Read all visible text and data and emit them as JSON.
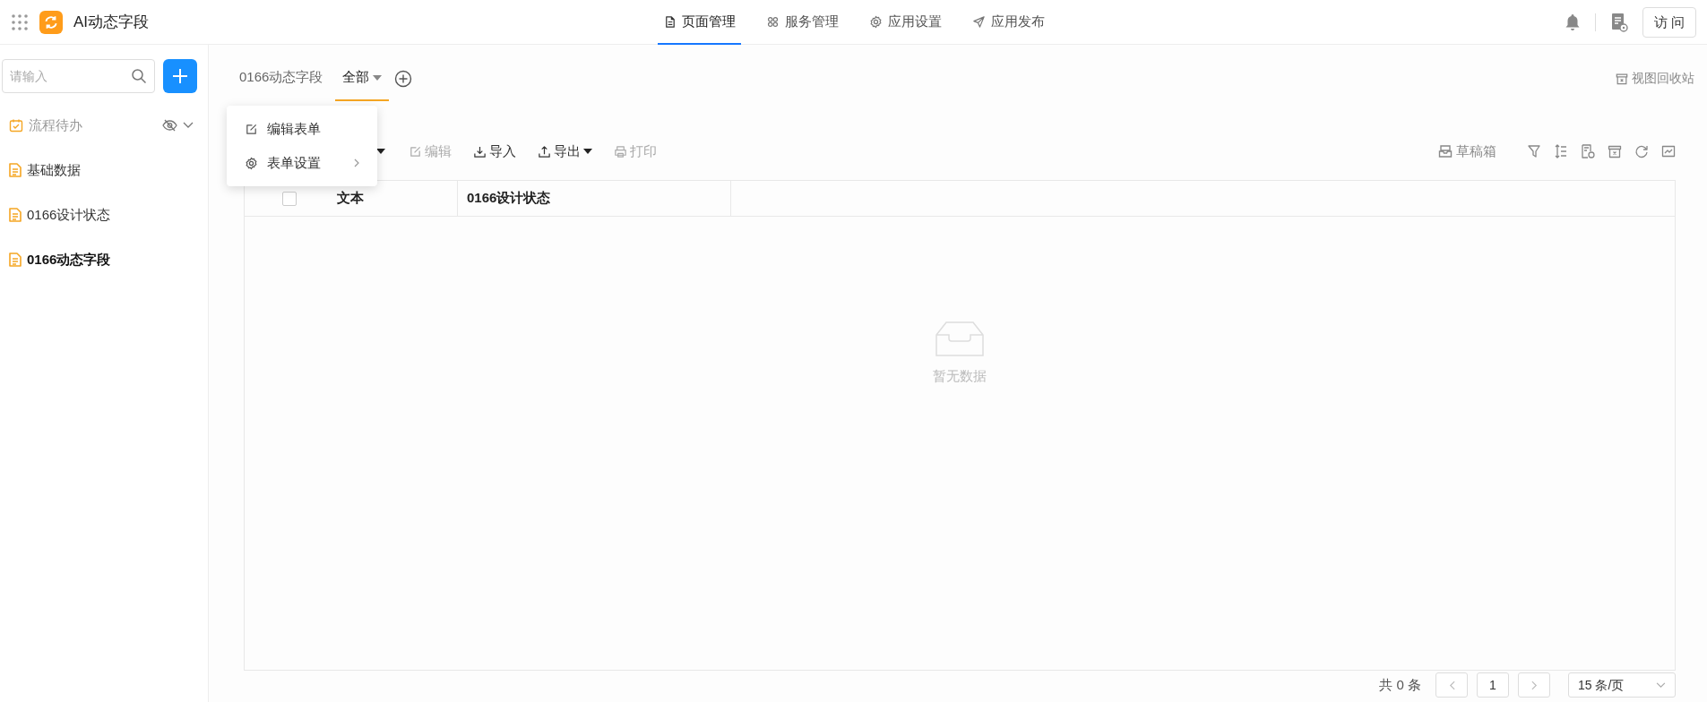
{
  "app": {
    "title": "AI动态字段"
  },
  "nav": [
    {
      "label": "页面管理",
      "selected": true
    },
    {
      "label": "服务管理",
      "selected": false
    },
    {
      "label": "应用设置",
      "selected": false
    },
    {
      "label": "应用发布",
      "selected": false
    }
  ],
  "visit_button": "访 问",
  "sidebar": {
    "search_placeholder": "请输入",
    "items": [
      {
        "kind": "todo",
        "label": "流程待办",
        "selected": false
      },
      {
        "kind": "form",
        "label": "基础数据",
        "selected": false
      },
      {
        "kind": "form",
        "label": "0166设计状态",
        "selected": false
      },
      {
        "kind": "form",
        "label": "0166动态字段",
        "selected": true
      }
    ]
  },
  "view_tabs": [
    {
      "label": "0166动态字段",
      "selected": false,
      "dropdown": false
    },
    {
      "label": "全部",
      "selected": true,
      "dropdown": true
    }
  ],
  "recycle_link": "视图回收站",
  "context_menu": [
    {
      "label": "编辑表单",
      "submenu": false
    },
    {
      "label": "表单设置",
      "submenu": true
    }
  ],
  "toolbar": [
    {
      "label": "编辑",
      "disabled": true,
      "dropdown": false
    },
    {
      "label": "导入",
      "disabled": false,
      "dropdown": false
    },
    {
      "label": "导出",
      "disabled": false,
      "dropdown": true
    },
    {
      "label": "打印",
      "disabled": true,
      "dropdown": false
    }
  ],
  "drafts_button": "草稿箱",
  "table": {
    "select_all_checked": false,
    "columns": [
      "文本",
      "0166设计状态"
    ],
    "empty_text": "暂无数据"
  },
  "pagination": {
    "total": "共 0 条",
    "page": "1",
    "page_size": "15 条/页"
  }
}
